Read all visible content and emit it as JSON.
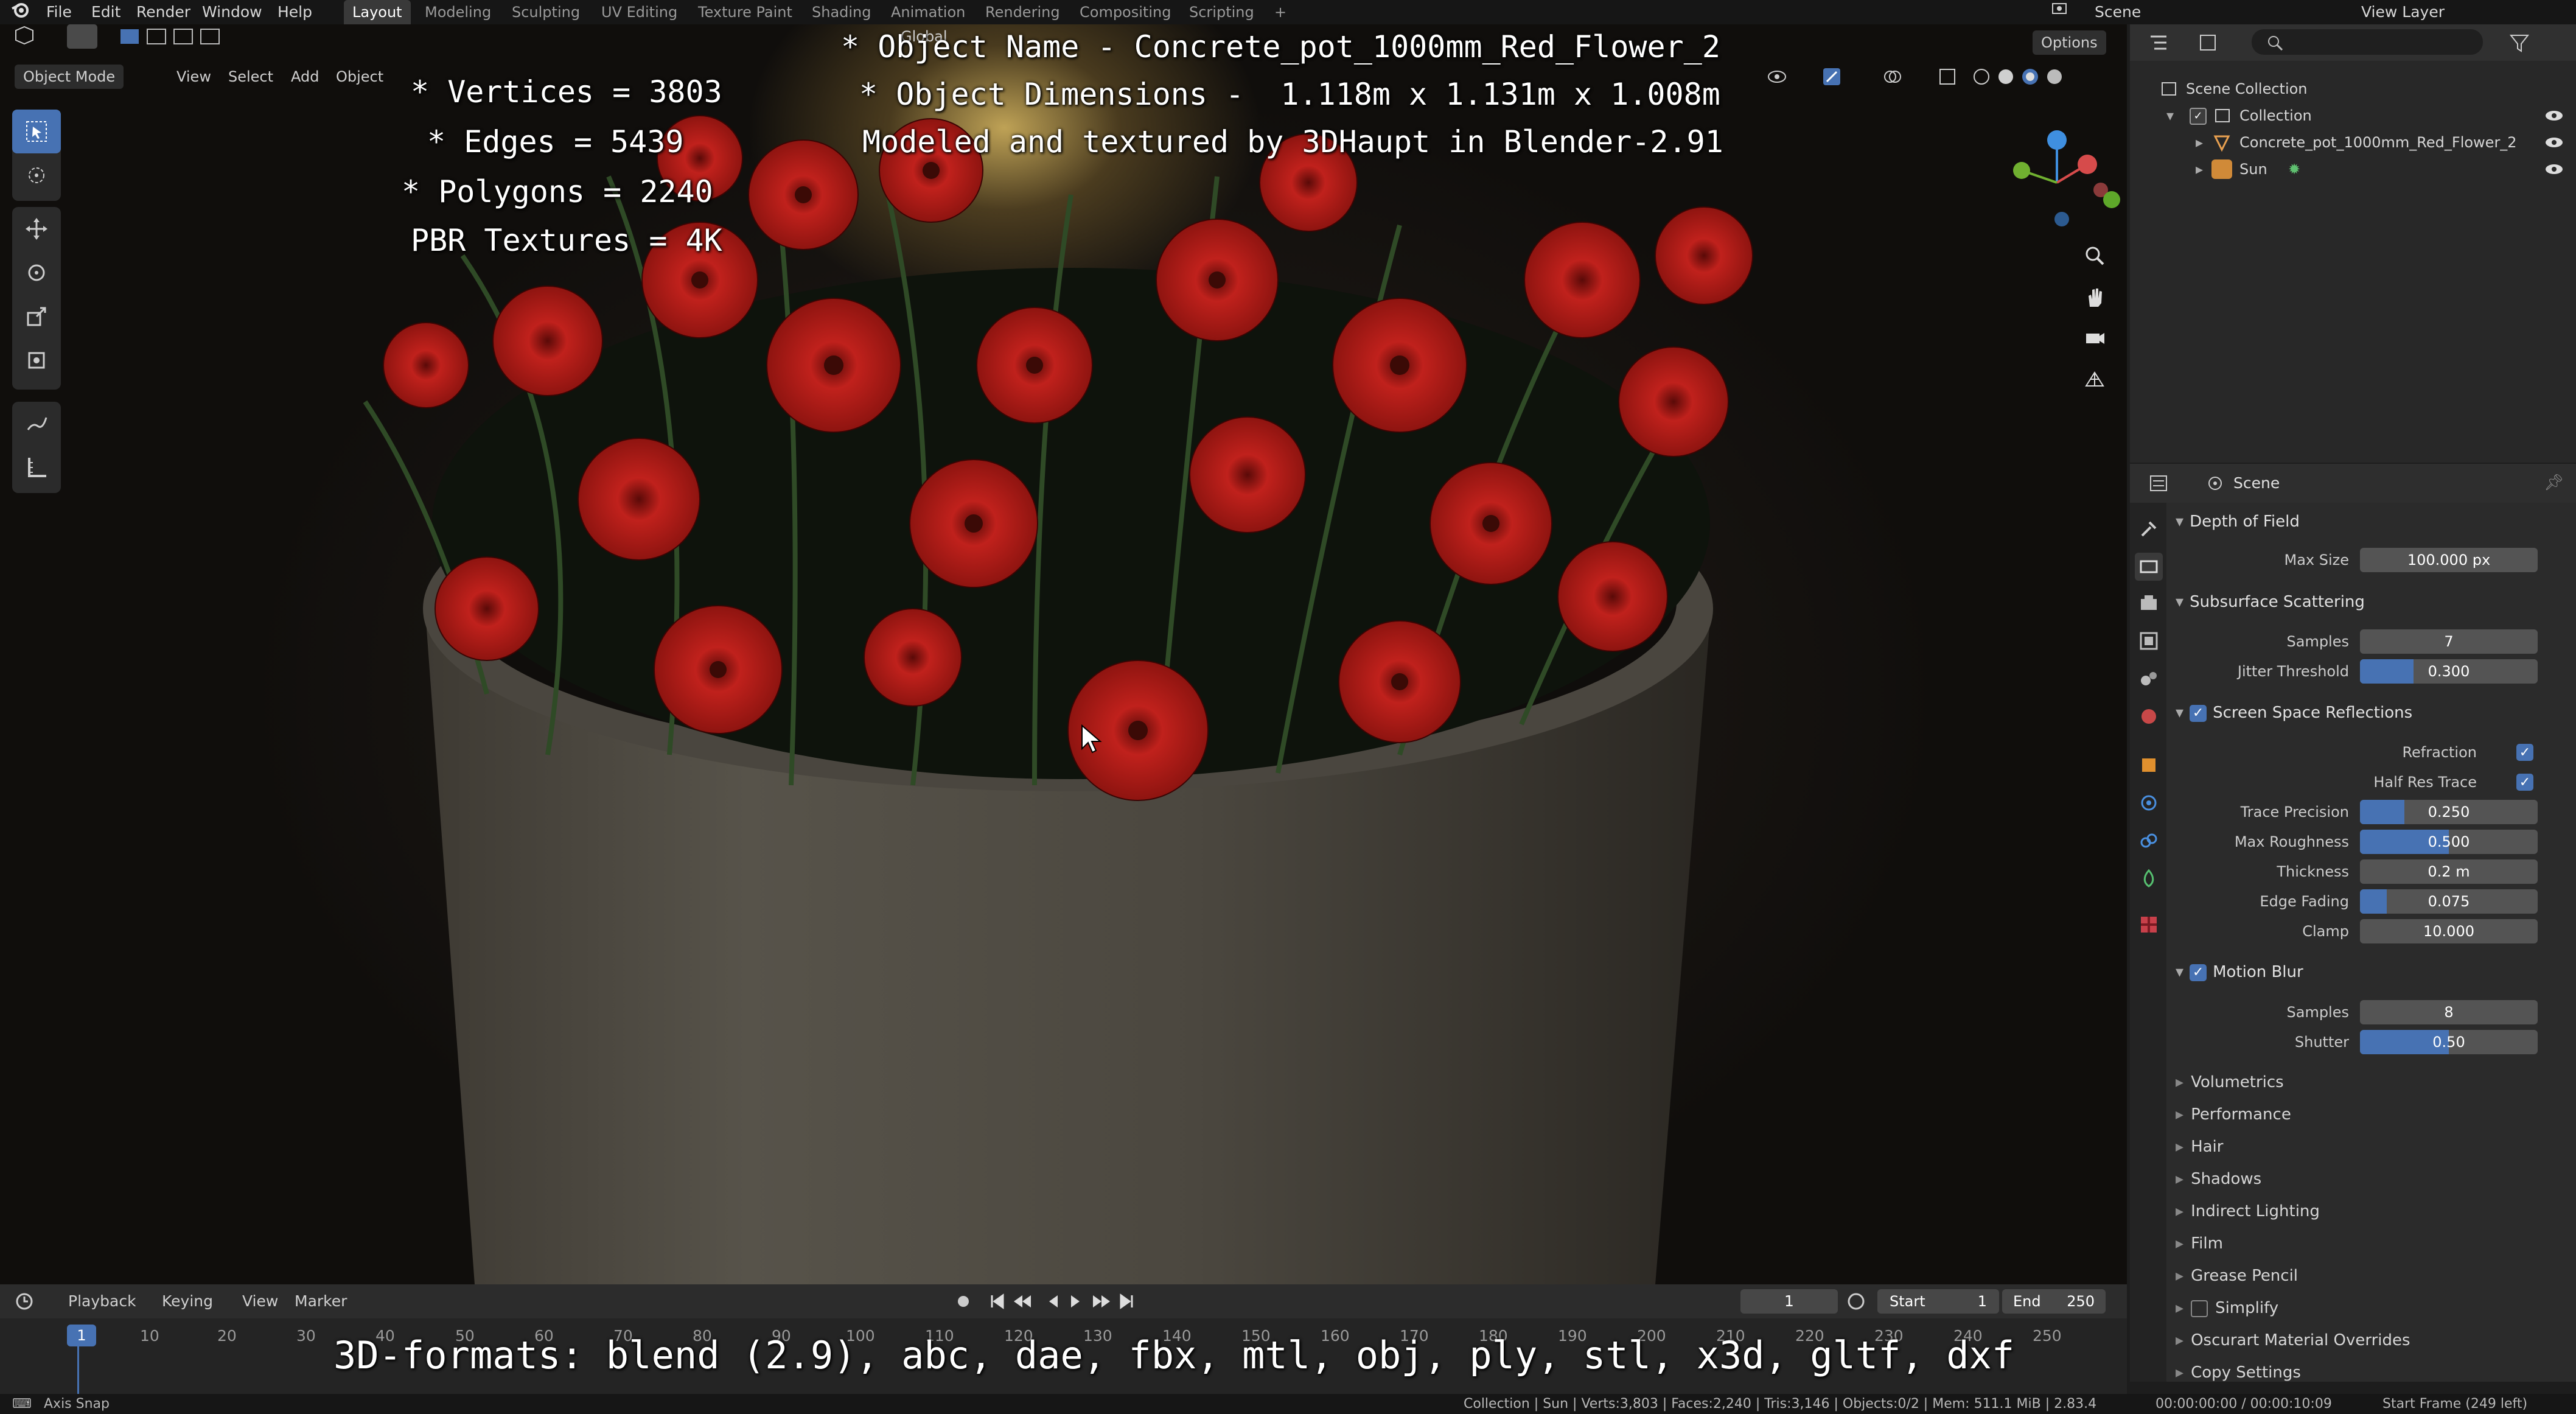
{
  "topbar": {
    "menu": [
      "File",
      "Edit",
      "Render",
      "Window",
      "Help"
    ],
    "workspaces": [
      "Layout",
      "Modeling",
      "Sculpting",
      "UV Editing",
      "Texture Paint",
      "Shading",
      "Animation",
      "Rendering",
      "Compositing",
      "Scripting"
    ],
    "active_workspace": "Layout",
    "scene_label": "Scene",
    "view_layer_label": "View Layer"
  },
  "viewport": {
    "mode": "Object Mode",
    "menus": [
      "View",
      "Select",
      "Add",
      "Object"
    ],
    "transform_orientation": "Global",
    "options_label": "Options"
  },
  "overlay": {
    "line1": "* Object Name - Concrete_pot_1000mm_Red_Flower_2",
    "line2": "* Object Dimensions -  1.118m x 1.131m x 1.008m",
    "line3": "Modeled and textured by 3DHaupt in Blender-2.91",
    "vertices": "* Vertices = 3803",
    "edges": "* Edges = 5439",
    "polygons": "* Polygons = 2240",
    "textures": "PBR Textures = 4K",
    "formats": "3D-formats: blend (2.9), abc, dae, fbx, mtl, obj, ply, stl, x3d, gltf, dxf"
  },
  "outliner": {
    "scene_collection": "Scene Collection",
    "collection": "Collection",
    "object": "Concrete_pot_1000mm_Red_Flower_2",
    "sun": "Sun"
  },
  "properties": {
    "context": "Scene",
    "dof": {
      "title": "Depth of Field",
      "max_size_label": "Max Size",
      "max_size": "100.000 px"
    },
    "sss": {
      "title": "Subsurface Scattering",
      "samples_label": "Samples",
      "samples": "7",
      "jitter_label": "Jitter Threshold",
      "jitter": "0.300",
      "jitter_fill": 0.3
    },
    "ssr": {
      "title": "Screen Space Reflections",
      "refraction_label": "Refraction",
      "half_res_label": "Half Res Trace",
      "trace_precision_label": "Trace Precision",
      "trace_precision": "0.250",
      "trace_precision_fill": 0.25,
      "max_roughness_label": "Max Roughness",
      "max_roughness": "0.500",
      "max_roughness_fill": 0.5,
      "thickness_label": "Thickness",
      "thickness": "0.2 m",
      "edge_fading_label": "Edge Fading",
      "edge_fading": "0.075",
      "edge_fading_fill": 0.15,
      "clamp_label": "Clamp",
      "clamp": "10.000"
    },
    "motion_blur": {
      "title": "Motion Blur",
      "samples_label": "Samples",
      "samples": "8",
      "shutter_label": "Shutter",
      "shutter": "0.50",
      "shutter_fill": 0.5
    },
    "collapsed_panels": [
      "Volumetrics",
      "Performance",
      "Hair",
      "Shadows",
      "Indirect Lighting",
      "Film",
      "Grease Pencil",
      "Simplify",
      "Oscurart Material Overrides",
      "Copy Settings"
    ]
  },
  "timeline": {
    "menus": [
      "Playback",
      "Keying",
      "View",
      "Marker"
    ],
    "current_frame": "1",
    "start_label": "Start",
    "start": "1",
    "end_label": "End",
    "end": "250",
    "frame_ticks": [
      "1",
      "10",
      "20",
      "30",
      "40",
      "50",
      "60",
      "70",
      "80",
      "90",
      "100",
      "110",
      "120",
      "130",
      "140",
      "150",
      "160",
      "170",
      "180",
      "190",
      "200",
      "210",
      "220",
      "230",
      "240",
      "250"
    ]
  },
  "statusbar": {
    "left": "Axis Snap",
    "stats": "Collection | Sun | Verts:3,803 | Faces:2,240 | Tris:3,146 | Objects:0/2 | Mem: 511.1 MiB | 2.83.4",
    "time": "00:00:00:00 / 00:00:10:09",
    "start_frame": "Start Frame (249 left)"
  }
}
